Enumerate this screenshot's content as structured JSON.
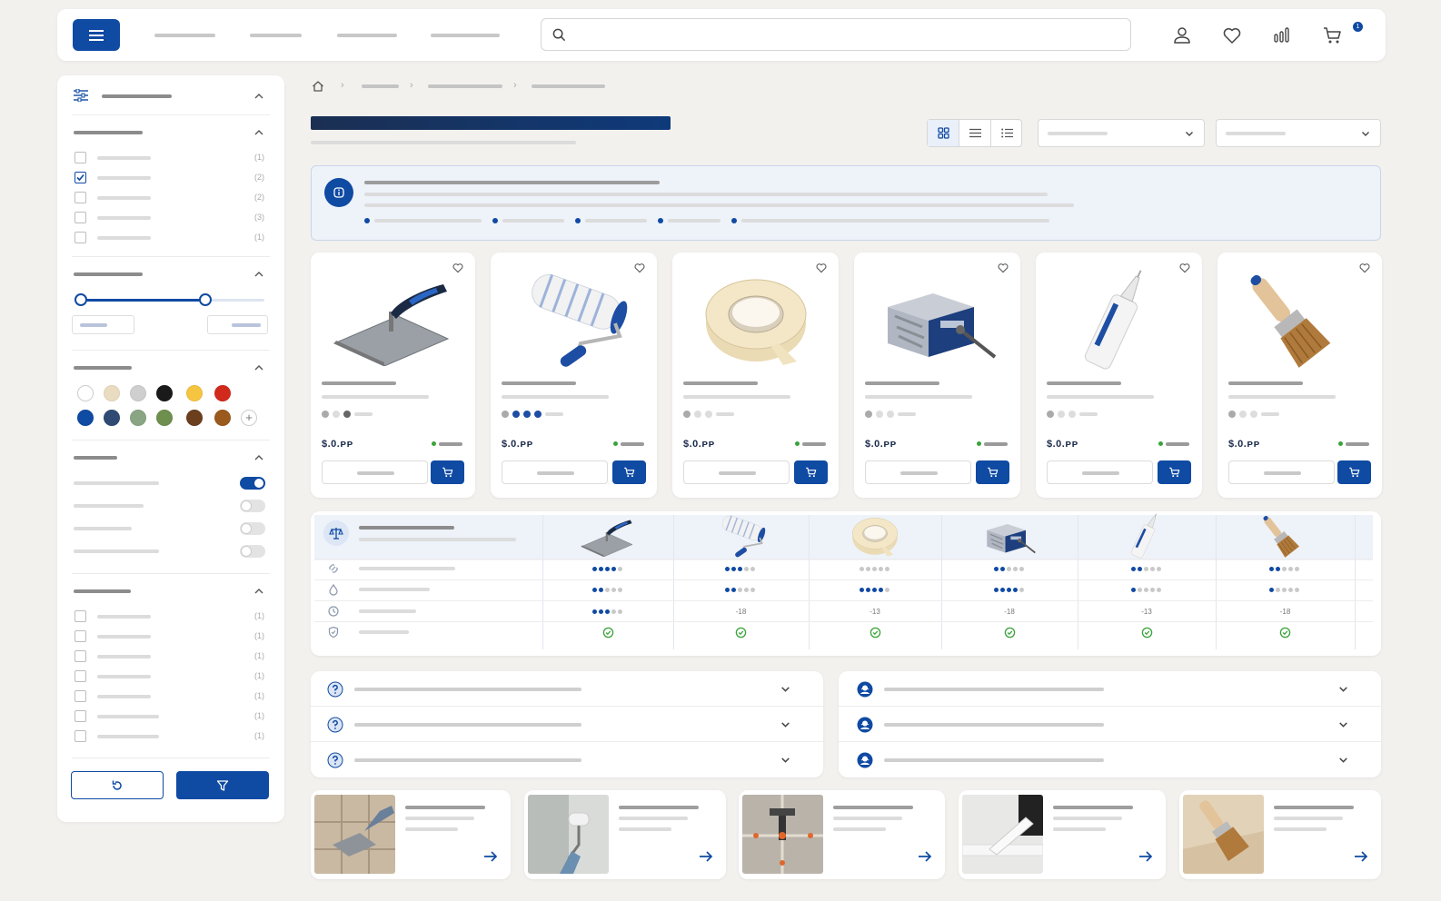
{
  "header": {
    "cart_count": "1",
    "search": {
      "placeholder": ""
    }
  },
  "colors": {
    "accent": "#0f4aa3",
    "background": "#f3f1ee",
    "info_background": "#eef2f9",
    "check_green": "#3aa33a",
    "in_stock_green": "#3aa33a"
  },
  "sidebar": {
    "checkbox_group_1": {
      "items": [
        {
          "count": "(1)",
          "checked": false
        },
        {
          "count": "(2)",
          "checked": true
        },
        {
          "count": "(2)",
          "checked": false
        },
        {
          "count": "(3)",
          "checked": false
        },
        {
          "count": "(1)",
          "checked": false
        }
      ]
    },
    "price_range": {
      "min_fraction": 0.0,
      "max_fraction": 0.7
    },
    "swatches": [
      "#ffffff",
      "#eadcc0",
      "#cfcfcf",
      "#1a1a1a",
      "#f5c542",
      "#d12a1c",
      "#0f4aa3",
      "#2f4a73",
      "#8aa583",
      "#6f8f4e",
      "#6b3e1e",
      "#9a5a1e"
    ],
    "toggles": [
      true,
      false,
      false,
      false
    ],
    "checkbox_group_2": {
      "items": [
        {
          "count": "(1)"
        },
        {
          "count": "(1)"
        },
        {
          "count": "(1)"
        },
        {
          "count": "(1)"
        },
        {
          "count": "(1)"
        },
        {
          "count": "(1)"
        },
        {
          "count": "(1)"
        }
      ]
    }
  },
  "view_modes": [
    "grid-icon",
    "list-icon",
    "compact-list-icon"
  ],
  "active_view": "grid",
  "products": [
    {
      "icon": "trowel-icon",
      "price": "$.0.ᴘᴘ",
      "in_stock": true
    },
    {
      "icon": "paint-roller-icon",
      "price": "$.0.ᴘᴘ",
      "in_stock": true
    },
    {
      "icon": "masking-tape-icon",
      "price": "$.0.ᴘᴘ",
      "in_stock": true
    },
    {
      "icon": "screws-box-icon",
      "price": "$.0.ᴘᴘ",
      "in_stock": true
    },
    {
      "icon": "sealant-tube-icon",
      "price": "$.0.ᴘᴘ",
      "in_stock": true
    },
    {
      "icon": "paint-brush-icon",
      "price": "$.0.ᴘᴘ",
      "in_stock": true
    }
  ],
  "comparison": {
    "row_icons": [
      "link-icon",
      "drop-icon",
      "clock-icon",
      "shield-icon"
    ],
    "ratings": [
      [
        4,
        2,
        3,
        "check"
      ],
      [
        3,
        2,
        "-18",
        "check"
      ],
      [
        0,
        4,
        "-13",
        "check"
      ],
      [
        2,
        4,
        "-18",
        "check"
      ],
      [
        2,
        1,
        "-13",
        "check"
      ],
      [
        2,
        1,
        "-18",
        "check"
      ]
    ]
  },
  "faq": {
    "left_icon": "question-icon",
    "right_icon": "support-icon",
    "rows": 3
  },
  "tutorials": [
    {
      "thumb": "tiling-thumb"
    },
    {
      "thumb": "roller-painting-thumb"
    },
    {
      "thumb": "tile-spacers-thumb"
    },
    {
      "thumb": "caulking-thumb"
    },
    {
      "thumb": "brush-painting-thumb"
    }
  ]
}
